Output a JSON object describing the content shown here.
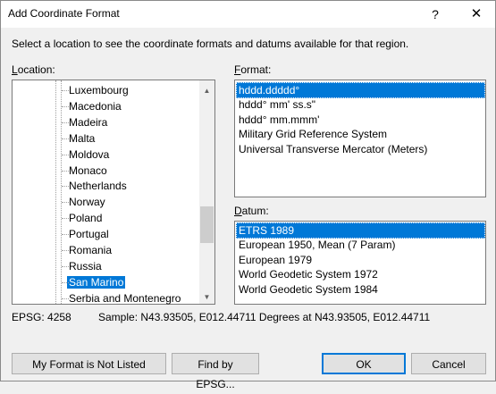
{
  "window": {
    "title": "Add Coordinate Format",
    "help_glyph": "?",
    "close_glyph": "✕",
    "description": "Select a location to see the coordinate formats and datums available for that region."
  },
  "location": {
    "label_mnemonic": "L",
    "label_rest": "ocation:",
    "items": [
      "Luxembourg",
      "Macedonia",
      "Madeira",
      "Malta",
      "Moldova",
      "Monaco",
      "Netherlands",
      "Norway",
      "Poland",
      "Portugal",
      "Romania",
      "Russia",
      "San Marino",
      "Serbia and Montenegro"
    ],
    "selected": "San Marino"
  },
  "format": {
    "label_mnemonic": "F",
    "label_rest": "ormat:",
    "items": [
      "hddd.ddddd°",
      "hddd° mm' ss.s\"",
      "hddd° mm.mmm'",
      "Military Grid Reference System",
      "Universal Transverse Mercator (Meters)"
    ],
    "selected": "hddd.ddddd°"
  },
  "datum": {
    "label_mnemonic": "D",
    "label_rest": "atum:",
    "items": [
      "ETRS 1989",
      "European 1950, Mean (7 Param)",
      "European 1979",
      "World Geodetic System 1972",
      "World Geodetic System 1984"
    ],
    "selected": "ETRS 1989"
  },
  "info": {
    "epsg": "EPSG: 4258",
    "sample": "Sample: N43.93505, E012.44711 Degrees at N43.93505, E012.44711"
  },
  "buttons": {
    "not_listed": "My Format is Not Listed",
    "find_epsg": "Find by EPSG...",
    "ok": "OK",
    "cancel": "Cancel"
  },
  "icons": {
    "scroll_up": "▲",
    "scroll_down": "▼"
  }
}
